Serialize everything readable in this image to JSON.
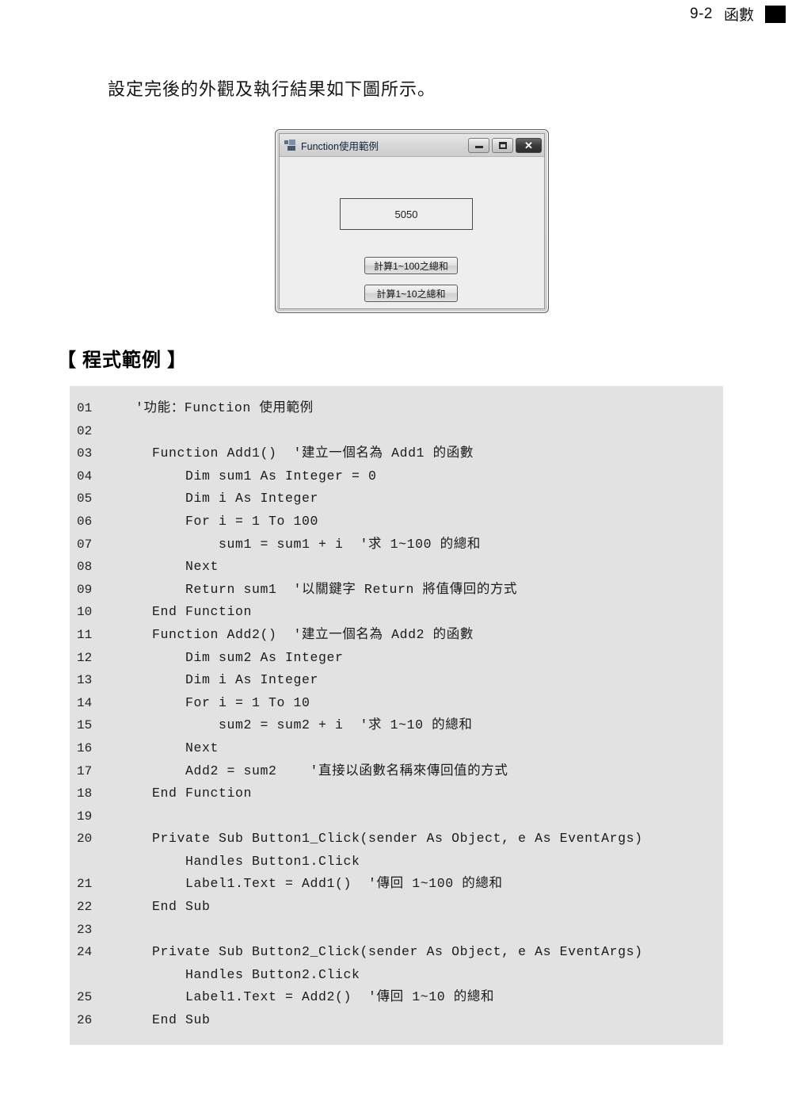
{
  "header": {
    "chapter_number": "9-2",
    "chapter_title": "函數",
    "corner_mark": "black-square"
  },
  "intro": {
    "text": "設定完後的外觀及執行結果如下圖所示。"
  },
  "form_window": {
    "title": "Function使用範例",
    "icon": "vb-form-icon",
    "window_buttons": {
      "minimize": "—",
      "maximize": "□",
      "close": "✕"
    },
    "label_value": "5050",
    "buttons": [
      {
        "label": "計算1~100之總和"
      },
      {
        "label": "計算1~10之總和"
      }
    ]
  },
  "section": {
    "heading": "【 程式範例 】"
  },
  "code": {
    "lines": [
      {
        "no": "01",
        "text": "  '功能：Function 使用範例"
      },
      {
        "no": "02",
        "text": ""
      },
      {
        "no": "03",
        "text": "    Function Add1()  '建立一個名為 Add1 的函數"
      },
      {
        "no": "04",
        "text": "        Dim sum1 As Integer = 0"
      },
      {
        "no": "05",
        "text": "        Dim i As Integer"
      },
      {
        "no": "06",
        "text": "        For i = 1 To 100"
      },
      {
        "no": "07",
        "text": "            sum1 = sum1 + i  '求 1~100 的總和"
      },
      {
        "no": "08",
        "text": "        Next"
      },
      {
        "no": "09",
        "text": "        Return sum1  '以關鍵字 Return 將值傳回的方式"
      },
      {
        "no": "10",
        "text": "    End Function"
      },
      {
        "no": "11",
        "text": "    Function Add2()  '建立一個名為 Add2 的函數"
      },
      {
        "no": "12",
        "text": "        Dim sum2 As Integer"
      },
      {
        "no": "13",
        "text": "        Dim i As Integer"
      },
      {
        "no": "14",
        "text": "        For i = 1 To 10"
      },
      {
        "no": "15",
        "text": "            sum2 = sum2 + i  '求 1~10 的總和"
      },
      {
        "no": "16",
        "text": "        Next"
      },
      {
        "no": "17",
        "text": "        Add2 = sum2    '直接以函數名稱來傳回值的方式"
      },
      {
        "no": "18",
        "text": "    End Function"
      },
      {
        "no": "19",
        "text": ""
      },
      {
        "no": "20",
        "text": "    Private Sub Button1_Click(sender As Object, e As EventArgs)"
      },
      {
        "no": "",
        "text": "        Handles Button1.Click"
      },
      {
        "no": "21",
        "text": "        Label1.Text = Add1()  '傳回 1~100 的總和"
      },
      {
        "no": "22",
        "text": "    End Sub"
      },
      {
        "no": "23",
        "text": ""
      },
      {
        "no": "24",
        "text": "    Private Sub Button2_Click(sender As Object, e As EventArgs)"
      },
      {
        "no": "",
        "text": "        Handles Button2.Click"
      },
      {
        "no": "25",
        "text": "        Label1.Text = Add2()  '傳回 1~10 的總和"
      },
      {
        "no": "26",
        "text": "    End Sub"
      }
    ]
  }
}
